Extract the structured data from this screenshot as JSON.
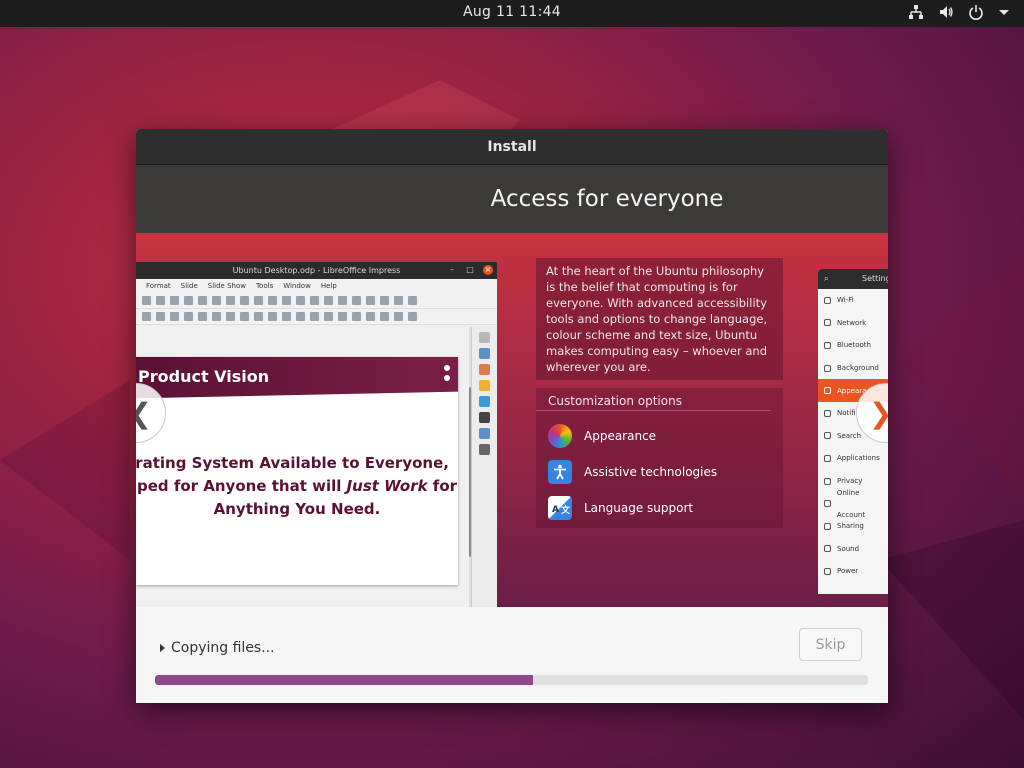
{
  "topbar": {
    "clock": "Aug 11  11:44",
    "tray_icons": [
      "network-icon",
      "volume-icon",
      "power-icon",
      "menu-chevron-icon"
    ]
  },
  "window": {
    "title": "Install",
    "banner_title": "Access for everyone"
  },
  "slide": {
    "libreoffice": {
      "title": "Ubuntu Desktop.odp - LibreOffice Impress",
      "menu": [
        "Format",
        "Slide",
        "Slide Show",
        "Tools",
        "Window",
        "Help"
      ],
      "slide_heading": "Product Vision",
      "slide_line1": "erating System Available to Everyone,",
      "slide_line2_pre": "ped for Anyone that will ",
      "slide_line2_em": "Just Work",
      "slide_line2_post": " for",
      "slide_line3": "Anything You Need."
    },
    "description": "At the heart of the Ubuntu philosophy is the belief that computing is for everyone. With advanced accessibility tools and options to change language, colour scheme and text size, Ubuntu makes computing easy – whoever and wherever you are.",
    "customization": {
      "heading": "Customization options",
      "options": [
        {
          "label": "Appearance",
          "icon": "appearance-icon"
        },
        {
          "label": "Assistive technologies",
          "icon": "accessibility-icon"
        },
        {
          "label": "Language support",
          "icon": "language-icon"
        }
      ]
    },
    "settings": {
      "title": "Setting",
      "items": [
        "Wi-Fi",
        "Network",
        "Bluetooth",
        "Background",
        "Appeara",
        "Notifi",
        "Search",
        "Applications",
        "Privacy",
        "Online Account",
        "Sharing",
        "Sound",
        "Power"
      ],
      "selected_index": 4
    },
    "prev_arrow": "❮",
    "next_arrow": "❯"
  },
  "status": {
    "text": "Copying files...",
    "skip_label": "Skip",
    "progress_percent": 53,
    "accent_color": "#8e4a8e"
  }
}
